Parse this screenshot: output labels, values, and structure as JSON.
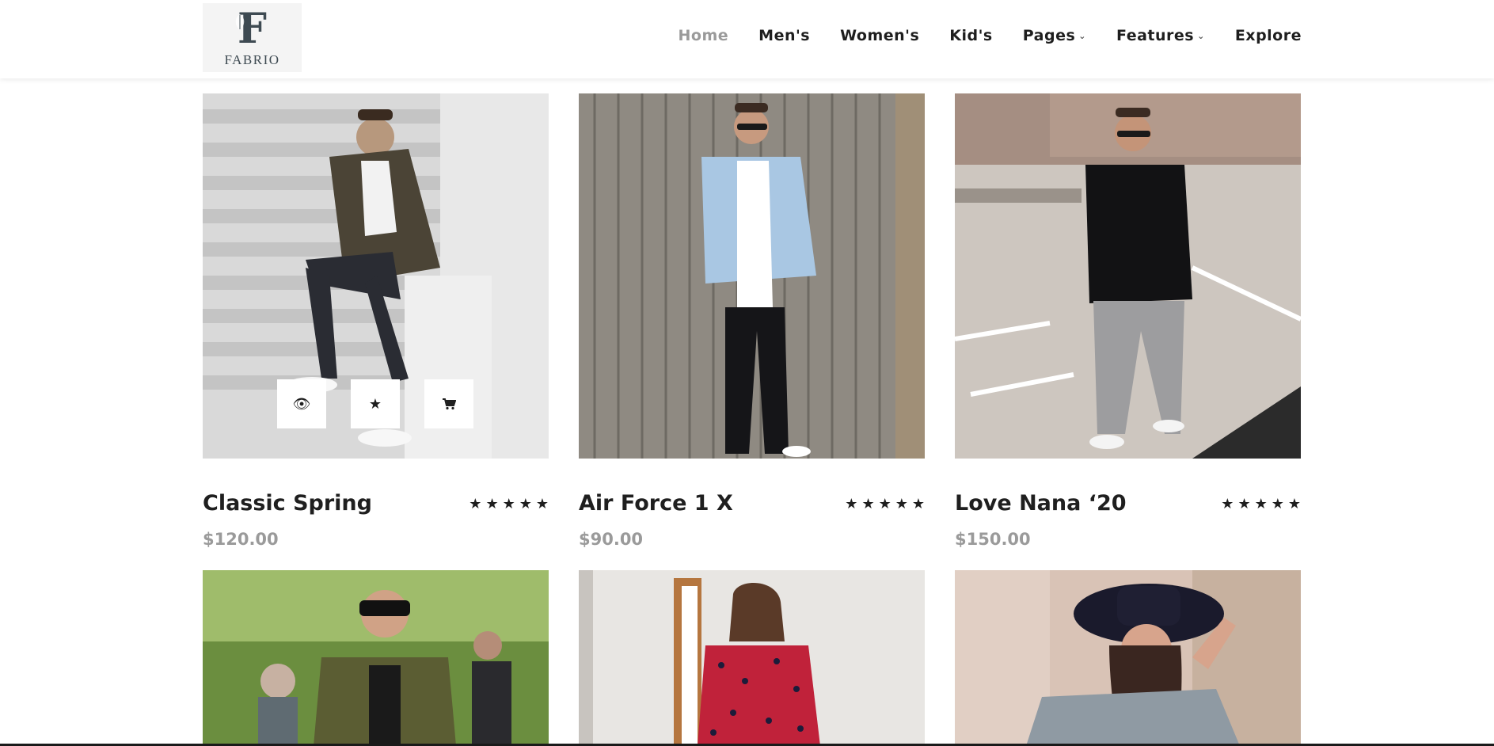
{
  "brand": {
    "initial": "F",
    "name": "FABRIO"
  },
  "nav": [
    {
      "label": "Home",
      "active": true,
      "dropdown": false
    },
    {
      "label": "Men's",
      "active": false,
      "dropdown": false
    },
    {
      "label": "Women's",
      "active": false,
      "dropdown": false
    },
    {
      "label": "Kid's",
      "active": false,
      "dropdown": false
    },
    {
      "label": "Pages",
      "active": false,
      "dropdown": true
    },
    {
      "label": "Features",
      "active": false,
      "dropdown": true
    },
    {
      "label": "Explore",
      "active": false,
      "dropdown": false
    }
  ],
  "products": [
    {
      "name": "Classic Spring",
      "price": "$120.00",
      "rating": 5
    },
    {
      "name": "Air Force 1 X",
      "price": "$90.00",
      "rating": 5
    },
    {
      "name": "Love Nana ‘20",
      "price": "$150.00",
      "rating": 5
    }
  ],
  "quick_actions": {
    "icons": [
      "eye-icon",
      "star-icon",
      "cart-icon"
    ]
  },
  "colors": {
    "text": "#1f1f1f",
    "muted": "#9a9a9a",
    "header_bg": "#ffffff"
  }
}
